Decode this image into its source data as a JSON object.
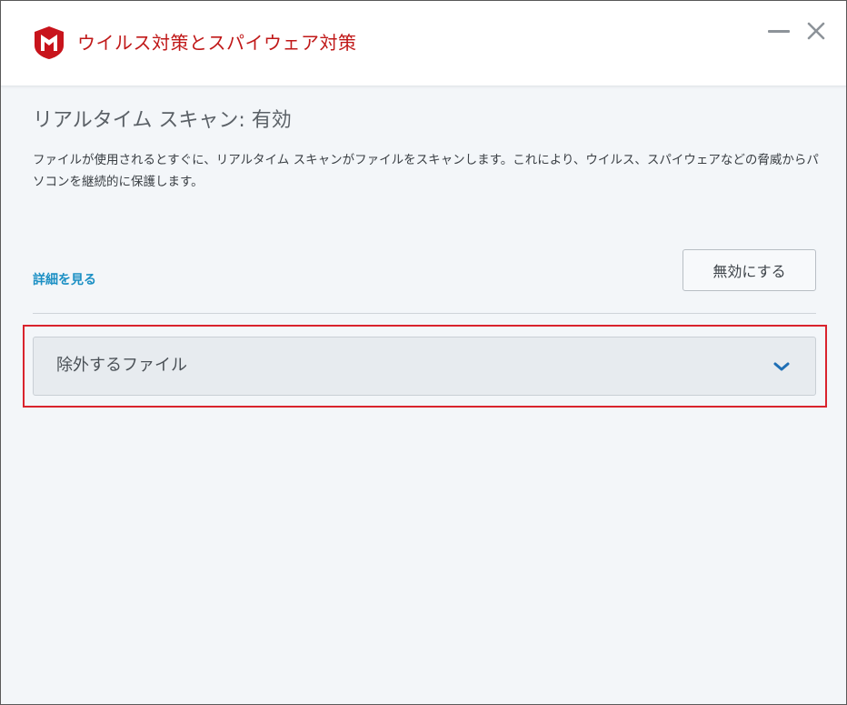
{
  "window": {
    "title": "ウイルス対策とスパイウェア対策",
    "logo_icon": "mcafee-shield-icon",
    "brand_color": "#c01818",
    "controls": {
      "minimize_icon": "minimize-icon",
      "close_icon": "close-icon"
    }
  },
  "main": {
    "section_title": "リアルタイム スキャン: 有効",
    "description": "ファイルが使用されるとすぐに、リアルタイム スキャンがファイルをスキャンします。これにより、ウイルス、スパイウェアなどの脅威からパソコンを継続的に保護します。",
    "details_link": "詳細を見る",
    "disable_button": "無効にする",
    "link_color": "#1a8fc4"
  },
  "exclusions": {
    "label": "除外するファイル",
    "expand_icon": "chevron-down-icon",
    "highlight_color": "#d9232d"
  }
}
